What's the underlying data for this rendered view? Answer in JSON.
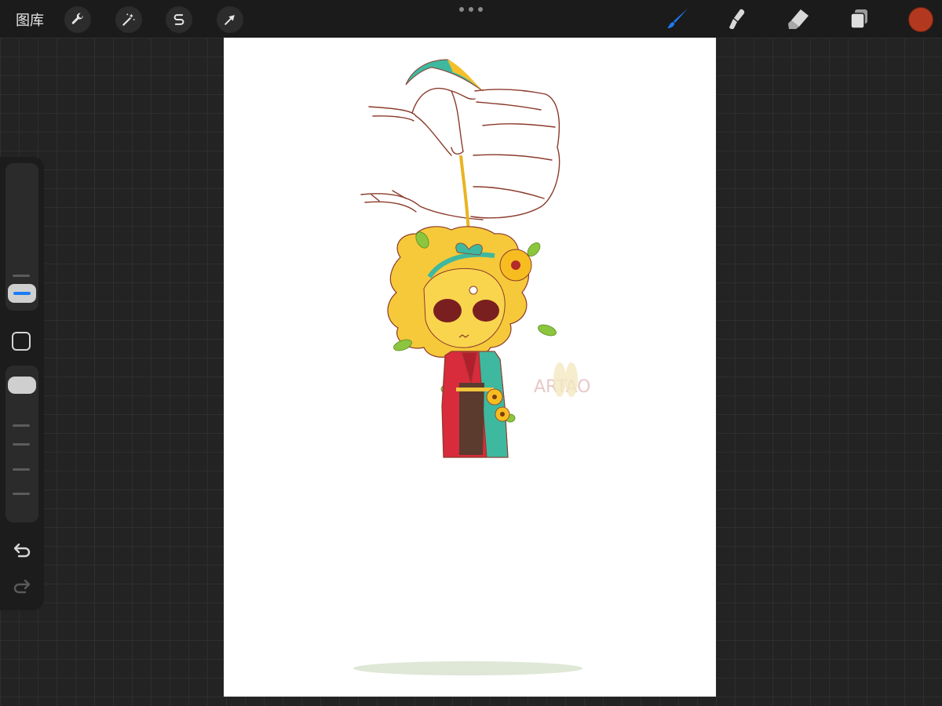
{
  "topbar": {
    "gallery_label": "图库",
    "left_tools": [
      {
        "icon": "wrench-icon"
      },
      {
        "icon": "magic-wand-icon"
      },
      {
        "icon": "selection-s-icon"
      },
      {
        "icon": "transform-arrow-icon"
      }
    ],
    "right_tools": [
      {
        "icon": "brush-icon",
        "active": true,
        "color": "#1a7cf5"
      },
      {
        "icon": "smudge-icon",
        "active": false
      },
      {
        "icon": "eraser-icon",
        "active": false
      },
      {
        "icon": "layers-icon",
        "active": false
      }
    ],
    "current_color": "#b2391f"
  },
  "sidebar": {
    "brush_size_indicator_color": "#1a7cf5",
    "icons": [
      "modify-square-icon",
      "undo-icon",
      "redo-icon"
    ]
  },
  "canvas": {
    "background": "#ffffff",
    "watermark_text": "ARTAO"
  }
}
